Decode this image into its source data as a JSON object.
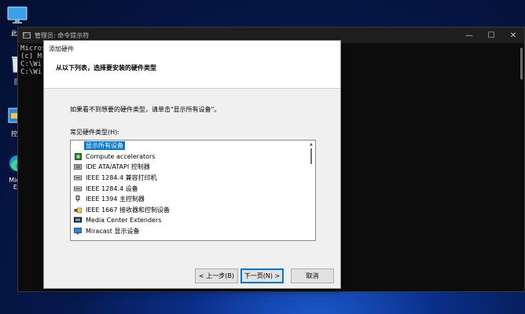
{
  "desktop": {
    "icons": [
      {
        "label": "此电",
        "icon": "monitor-icon"
      },
      {
        "label": "回",
        "icon": "recycle-bin-icon"
      },
      {
        "label": "控制",
        "icon": "control-panel-icon"
      },
      {
        "label": "Micro",
        "label2": "Ed",
        "icon": "edge-icon"
      }
    ]
  },
  "console": {
    "title": "管理员: 命令提示符",
    "icon_text": "C:\\",
    "lines": [
      "Micros",
      "(c) Mi",
      "",
      "C:\\Wi",
      "",
      "C:\\Wi"
    ],
    "controls": [
      "—",
      "☐",
      "✕"
    ]
  },
  "dialog": {
    "title": "添加硬件",
    "header": "从以下列表，选择要安装的硬件类型",
    "instruction": "如果看不到想要的硬件类型，请单击\"显示所有设备\"。",
    "list_label": "常见硬件类型(H):",
    "items": [
      {
        "label": "显示所有设备",
        "selected": true
      },
      {
        "label": "Compute accelerators"
      },
      {
        "label": "IDE ATA/ATAPI 控制器"
      },
      {
        "label": "IEEE 1284.4 兼容打印机"
      },
      {
        "label": "IEEE 1284.4 设备"
      },
      {
        "label": "IEEE 1394 主控制器"
      },
      {
        "label": "IEEE 1667 接收器和控制设备"
      },
      {
        "label": "Media Center Extenders"
      },
      {
        "label": "Miracast 显示设备"
      }
    ],
    "buttons": {
      "back": "< 上一步(B)",
      "next": "下一页(N) >",
      "cancel": "取消"
    }
  }
}
